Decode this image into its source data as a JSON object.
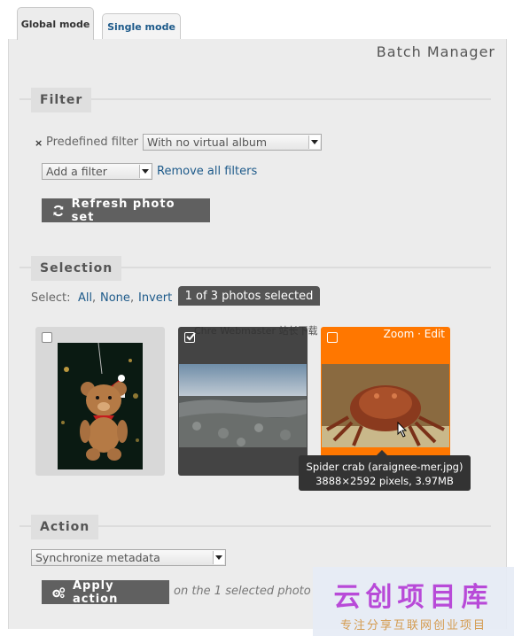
{
  "tabs": [
    {
      "label": "Global mode",
      "active": true
    },
    {
      "label": "Single mode",
      "active": false
    }
  ],
  "page_title": "Batch Manager",
  "filter": {
    "legend": "Filter",
    "remove_icon": "×",
    "predefined_label": "Predefined filter",
    "predefined_value": "With no virtual album",
    "add_filter_value": "Add a filter",
    "remove_all_label": "Remove all filters",
    "refresh_label": "Refresh photo set"
  },
  "selection": {
    "legend": "Selection",
    "select_label": "Select:",
    "all_label": "All",
    "none_label": "None",
    "invert_label": "Invert",
    "sep": ",",
    "count_text": "1 of 3 photos selected",
    "overlay_text": "Chre Webmaster 站长下载",
    "photos": [
      {
        "checked": false
      },
      {
        "checked": true
      },
      {
        "checked": false,
        "hovered": true,
        "zoom_label": "Zoom",
        "dot": "·",
        "edit_label": "Edit"
      }
    ],
    "tooltip": {
      "line1": "Spider crab (araignee-mer.jpg)",
      "line2": "3888×2592 pixels, 3.97MB"
    }
  },
  "action": {
    "legend": "Action",
    "select_value": "Synchronize metadata",
    "apply_label": "Apply action",
    "on_selected_text": "on the 1 selected photo"
  },
  "watermark": {
    "title": "云创项目库",
    "subtitle": "专注分享互联网创业项目"
  },
  "colors": {
    "accent_orange": "#ff7700",
    "link_blue": "#1d5a8a",
    "button_gray": "#606060",
    "panel_bg": "#ececec"
  }
}
